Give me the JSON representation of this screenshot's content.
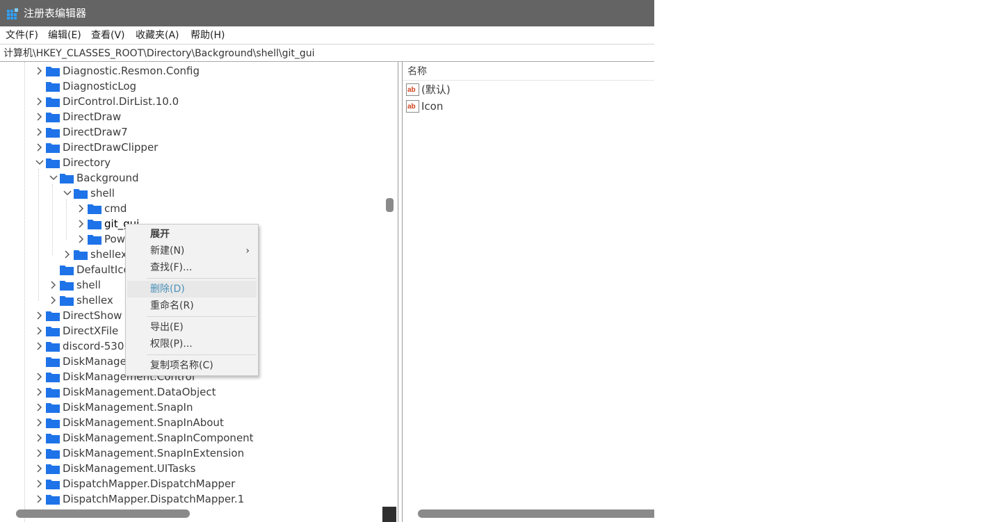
{
  "title_bar": {
    "title": "注册表编辑器",
    "icon": "regedit-icon"
  },
  "menu": [
    "文件(F)",
    "编辑(E)",
    "查看(V)",
    "收藏夹(A)",
    "帮助(H)"
  ],
  "address": "计算机\\HKEY_CLASSES_ROOT\\Directory\\Background\\shell\\git_gui",
  "colors": {
    "titlebar": "#646464",
    "folder": "#1e73e8",
    "menu_hover_text": "#4a90b8",
    "context_bg": "#f2f2f2"
  },
  "tree": [
    {
      "label": "Diagnostic.Resmon.Config",
      "depth": 0,
      "chevron": "right"
    },
    {
      "label": "DiagnosticLog",
      "depth": 0,
      "chevron": "none"
    },
    {
      "label": "DirControl.DirList.10.0",
      "depth": 0,
      "chevron": "right"
    },
    {
      "label": "DirectDraw",
      "depth": 0,
      "chevron": "right"
    },
    {
      "label": "DirectDraw7",
      "depth": 0,
      "chevron": "right"
    },
    {
      "label": "DirectDrawClipper",
      "depth": 0,
      "chevron": "right"
    },
    {
      "label": "Directory",
      "depth": 0,
      "chevron": "down"
    },
    {
      "label": "Background",
      "depth": 1,
      "chevron": "down"
    },
    {
      "label": "shell",
      "depth": 2,
      "chevron": "down"
    },
    {
      "label": "cmd",
      "depth": 3,
      "chevron": "right"
    },
    {
      "label": "git_gui",
      "depth": 3,
      "chevron": "right",
      "selected": true
    },
    {
      "label": "Pow",
      "depth": 3,
      "chevron": "right"
    },
    {
      "label": "shellex",
      "depth": 2,
      "chevron": "right"
    },
    {
      "label": "DefaultIco",
      "depth": 1,
      "chevron": "none"
    },
    {
      "label": "shell",
      "depth": 1,
      "chevron": "right"
    },
    {
      "label": "shellex",
      "depth": 1,
      "chevron": "right"
    },
    {
      "label": "DirectShow",
      "depth": 0,
      "chevron": "right"
    },
    {
      "label": "DirectXFile",
      "depth": 0,
      "chevron": "right"
    },
    {
      "label": "discord-530",
      "depth": 0,
      "chevron": "right"
    },
    {
      "label": "DiskManage",
      "depth": 0,
      "chevron": "none"
    },
    {
      "label": "DiskManagement.Control",
      "depth": 0,
      "chevron": "right"
    },
    {
      "label": "DiskManagement.DataObject",
      "depth": 0,
      "chevron": "right"
    },
    {
      "label": "DiskManagement.SnapIn",
      "depth": 0,
      "chevron": "right"
    },
    {
      "label": "DiskManagement.SnapInAbout",
      "depth": 0,
      "chevron": "right"
    },
    {
      "label": "DiskManagement.SnapInComponent",
      "depth": 0,
      "chevron": "right"
    },
    {
      "label": "DiskManagement.SnapInExtension",
      "depth": 0,
      "chevron": "right"
    },
    {
      "label": "DiskManagement.UITasks",
      "depth": 0,
      "chevron": "right"
    },
    {
      "label": "DispatchMapper.DispatchMapper",
      "depth": 0,
      "chevron": "right"
    },
    {
      "label": "DispatchMapper.DispatchMapper.1",
      "depth": 0,
      "chevron": "right"
    }
  ],
  "values_pane": {
    "header": "名称",
    "rows": [
      {
        "icon": "string-value-icon",
        "name": "(默认)"
      },
      {
        "icon": "string-value-icon",
        "name": "Icon"
      }
    ]
  },
  "context_menu": {
    "items": [
      {
        "label": "展开",
        "bold": true
      },
      {
        "label": "新建(N)",
        "submenu": true,
        "arrow": "›"
      },
      {
        "label": "查找(F)..."
      },
      {
        "separator": true
      },
      {
        "label": "删除(D)",
        "hover": true
      },
      {
        "label": "重命名(R)"
      },
      {
        "separator": true
      },
      {
        "label": "导出(E)"
      },
      {
        "label": "权限(P)..."
      },
      {
        "separator": true
      },
      {
        "label": "复制项名称(C)"
      }
    ]
  }
}
